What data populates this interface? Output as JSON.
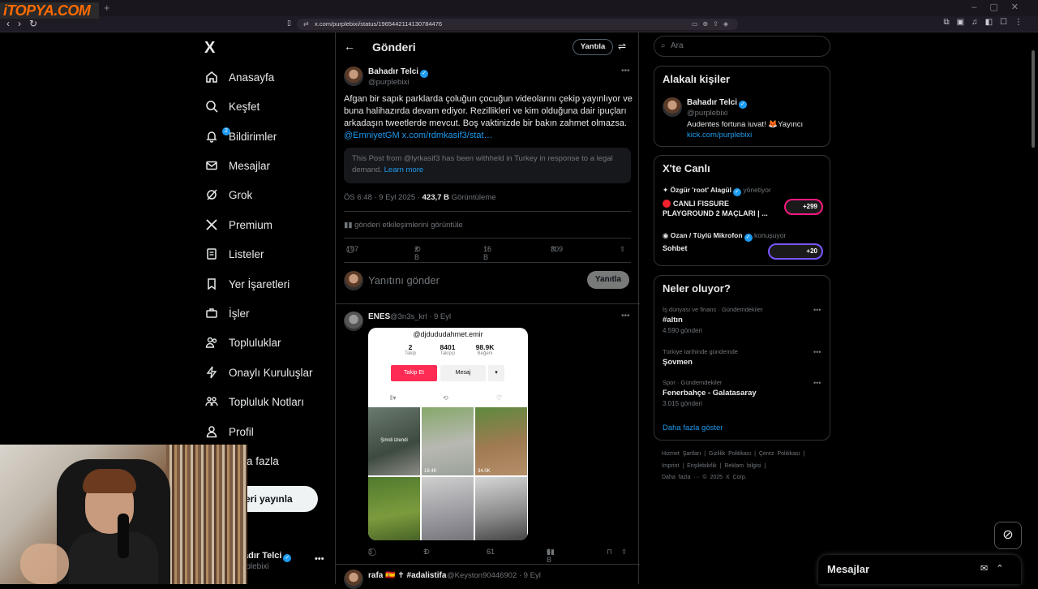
{
  "browser": {
    "watermark": "iTOPYA.COM",
    "new_tab": "+",
    "url": "x.com/purplebixi/status/1965442114130784476"
  },
  "sidebar": {
    "logo": "X",
    "items": [
      {
        "label": "Anasayfa",
        "icon": "home-icon"
      },
      {
        "label": "Keşfet",
        "icon": "search-icon"
      },
      {
        "label": "Bildirimler",
        "icon": "bell-icon",
        "badge": "2"
      },
      {
        "label": "Mesajlar",
        "icon": "mail-icon"
      },
      {
        "label": "Grok",
        "icon": "grok-icon"
      },
      {
        "label": "Premium",
        "icon": "x-icon"
      },
      {
        "label": "Listeler",
        "icon": "list-icon"
      },
      {
        "label": "Yer İşaretleri",
        "icon": "bookmark-icon"
      },
      {
        "label": "İşler",
        "icon": "briefcase-icon"
      },
      {
        "label": "Topluluklar",
        "icon": "people-icon"
      },
      {
        "label": "Onaylı Kuruluşlar",
        "icon": "lightning-icon"
      },
      {
        "label": "Topluluk Notları",
        "icon": "notes-icon"
      },
      {
        "label": "Profil",
        "icon": "person-icon"
      },
      {
        "label": "a fazla",
        "icon": "more-icon"
      }
    ],
    "post_button": "eri yayınla",
    "account_name": "adır Telci",
    "account_handle": "rplebixi"
  },
  "header": {
    "title": "Gönderi",
    "reply_label": "Yantıla"
  },
  "post": {
    "author": "Bahadır Telci",
    "handle": "@purplebixi",
    "text": "Afgan bir sapık parklarda çoluğun çocuğun videolarını çekip yayınlıyor ve buna halihazırda devam ediyor. Rezillikleri ve kim olduğuna dair ipuçları arkadaşın tweetlerde mevcut. Boş vaktinizde bir bakın zahmet olmazsa.",
    "mention": "@EmniyetGM",
    "link": "x.com/rdmkasif3/stat…",
    "withheld": "This Post from @lyrkasif3 has been withheld in Turkey in response to a legal demand.",
    "learn_more": "Learn more",
    "time": "ÖS 6:48 · 9 Eyl 2025 ·",
    "views": "423,7 B",
    "views_label": "Görüntüleme",
    "engagements": "gönderi etkileşimlerini görüntüle",
    "replies": "197",
    "reposts": "2 B",
    "likes": "16 B",
    "bookmarks": "309"
  },
  "compose": {
    "placeholder": "Yanıtını gönder",
    "button": "Yanıtla"
  },
  "reply1": {
    "author": "ENES",
    "handle": "@3n3s_krl · 9 Eyl",
    "media": {
      "username": "@djdududahmet.emir",
      "following": "2",
      "following_label": "Takip",
      "followers": "8401",
      "followers_label": "Takipçi",
      "likes": "98.9K",
      "likes_label": "Beğeni",
      "follow_btn": "Takip Et",
      "message_btn": "Mesaj",
      "pinned": "Şimdi izlendi",
      "views": [
        "18.4K",
        "34.0K"
      ]
    },
    "replies": "3",
    "reposts": "1",
    "likes": "61",
    "views": "6 B"
  },
  "reply2": {
    "author": "rafa 🇪🇸 ✝ #adalistifa",
    "handle": "@Keyston90446902 · 9 Eyl"
  },
  "right": {
    "search_placeholder": "Ara",
    "relevant_title": "Alakalı kişiler",
    "relevant_name": "Bahadır Telci",
    "relevant_handle": "@purplebixi",
    "relevant_bio": "Audentes fortuna iuvat! 🦊Yayıncı",
    "relevant_link": "kick.com/purplebixi",
    "live_title": "X'te Canlı",
    "live1_host": "Özgür 'root' Alagül",
    "live1_role": "yönetiyor",
    "live1_title": "CANLI FISSURE PLAYGROUND 2 MAÇLARI | ...",
    "live1_count": "+299",
    "live2_host": "Ozan / Tüylü Mikrofon",
    "live2_role": "konuşuyor",
    "live2_title": "Sohbet",
    "live2_count": "+20",
    "trends_title": "Neler oluyor?",
    "trends": [
      {
        "meta": "İş dünyası ve finans · Gündemdekiler",
        "name": "#altın",
        "count": "4.590 gönderi"
      },
      {
        "meta": "Türkiye tarihinde gündemde",
        "name": "Şovmen",
        "count": ""
      },
      {
        "meta": "Spor · Gündemdekiler",
        "name": "Fenerbahçe - Galatasaray",
        "count": "3.015 gönderi"
      }
    ],
    "show_more": "Daha fazla göster",
    "footer1": "Hizmet Şartları | Gizlilik Politikası | Çerez Politikası |",
    "footer2": "Imprint | Erişilebilirlik | Reklam bilgisi |",
    "footer3": "Daha fazla ··· © 2025 X Corp."
  },
  "messages_bar": {
    "title": "Mesajlar"
  },
  "colors": {
    "accent": "#1d9bf0",
    "background": "#000000",
    "border": "#2f3336",
    "muted": "#71767b",
    "live": "#f91880"
  }
}
